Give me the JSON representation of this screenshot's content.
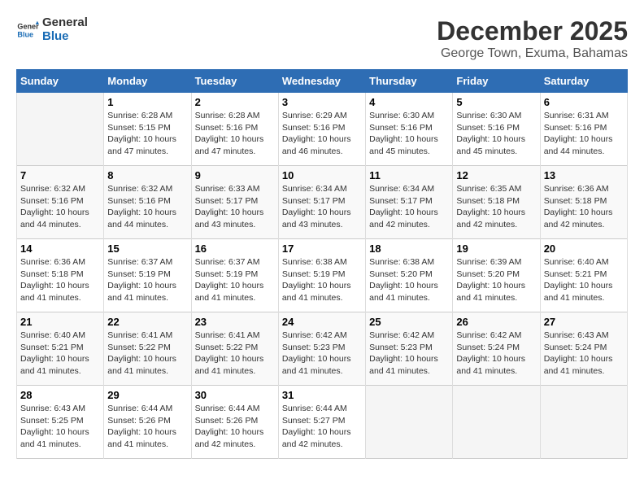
{
  "logo": {
    "general": "General",
    "blue": "Blue"
  },
  "title": "December 2025",
  "location": "George Town, Exuma, Bahamas",
  "days_of_week": [
    "Sunday",
    "Monday",
    "Tuesday",
    "Wednesday",
    "Thursday",
    "Friday",
    "Saturday"
  ],
  "weeks": [
    [
      {
        "num": "",
        "sunrise": "",
        "sunset": "",
        "daylight": ""
      },
      {
        "num": "1",
        "sunrise": "Sunrise: 6:28 AM",
        "sunset": "Sunset: 5:15 PM",
        "daylight": "Daylight: 10 hours and 47 minutes."
      },
      {
        "num": "2",
        "sunrise": "Sunrise: 6:28 AM",
        "sunset": "Sunset: 5:16 PM",
        "daylight": "Daylight: 10 hours and 47 minutes."
      },
      {
        "num": "3",
        "sunrise": "Sunrise: 6:29 AM",
        "sunset": "Sunset: 5:16 PM",
        "daylight": "Daylight: 10 hours and 46 minutes."
      },
      {
        "num": "4",
        "sunrise": "Sunrise: 6:30 AM",
        "sunset": "Sunset: 5:16 PM",
        "daylight": "Daylight: 10 hours and 45 minutes."
      },
      {
        "num": "5",
        "sunrise": "Sunrise: 6:30 AM",
        "sunset": "Sunset: 5:16 PM",
        "daylight": "Daylight: 10 hours and 45 minutes."
      },
      {
        "num": "6",
        "sunrise": "Sunrise: 6:31 AM",
        "sunset": "Sunset: 5:16 PM",
        "daylight": "Daylight: 10 hours and 44 minutes."
      }
    ],
    [
      {
        "num": "7",
        "sunrise": "Sunrise: 6:32 AM",
        "sunset": "Sunset: 5:16 PM",
        "daylight": "Daylight: 10 hours and 44 minutes."
      },
      {
        "num": "8",
        "sunrise": "Sunrise: 6:32 AM",
        "sunset": "Sunset: 5:16 PM",
        "daylight": "Daylight: 10 hours and 44 minutes."
      },
      {
        "num": "9",
        "sunrise": "Sunrise: 6:33 AM",
        "sunset": "Sunset: 5:17 PM",
        "daylight": "Daylight: 10 hours and 43 minutes."
      },
      {
        "num": "10",
        "sunrise": "Sunrise: 6:34 AM",
        "sunset": "Sunset: 5:17 PM",
        "daylight": "Daylight: 10 hours and 43 minutes."
      },
      {
        "num": "11",
        "sunrise": "Sunrise: 6:34 AM",
        "sunset": "Sunset: 5:17 PM",
        "daylight": "Daylight: 10 hours and 42 minutes."
      },
      {
        "num": "12",
        "sunrise": "Sunrise: 6:35 AM",
        "sunset": "Sunset: 5:18 PM",
        "daylight": "Daylight: 10 hours and 42 minutes."
      },
      {
        "num": "13",
        "sunrise": "Sunrise: 6:36 AM",
        "sunset": "Sunset: 5:18 PM",
        "daylight": "Daylight: 10 hours and 42 minutes."
      }
    ],
    [
      {
        "num": "14",
        "sunrise": "Sunrise: 6:36 AM",
        "sunset": "Sunset: 5:18 PM",
        "daylight": "Daylight: 10 hours and 41 minutes."
      },
      {
        "num": "15",
        "sunrise": "Sunrise: 6:37 AM",
        "sunset": "Sunset: 5:19 PM",
        "daylight": "Daylight: 10 hours and 41 minutes."
      },
      {
        "num": "16",
        "sunrise": "Sunrise: 6:37 AM",
        "sunset": "Sunset: 5:19 PM",
        "daylight": "Daylight: 10 hours and 41 minutes."
      },
      {
        "num": "17",
        "sunrise": "Sunrise: 6:38 AM",
        "sunset": "Sunset: 5:19 PM",
        "daylight": "Daylight: 10 hours and 41 minutes."
      },
      {
        "num": "18",
        "sunrise": "Sunrise: 6:38 AM",
        "sunset": "Sunset: 5:20 PM",
        "daylight": "Daylight: 10 hours and 41 minutes."
      },
      {
        "num": "19",
        "sunrise": "Sunrise: 6:39 AM",
        "sunset": "Sunset: 5:20 PM",
        "daylight": "Daylight: 10 hours and 41 minutes."
      },
      {
        "num": "20",
        "sunrise": "Sunrise: 6:40 AM",
        "sunset": "Sunset: 5:21 PM",
        "daylight": "Daylight: 10 hours and 41 minutes."
      }
    ],
    [
      {
        "num": "21",
        "sunrise": "Sunrise: 6:40 AM",
        "sunset": "Sunset: 5:21 PM",
        "daylight": "Daylight: 10 hours and 41 minutes."
      },
      {
        "num": "22",
        "sunrise": "Sunrise: 6:41 AM",
        "sunset": "Sunset: 5:22 PM",
        "daylight": "Daylight: 10 hours and 41 minutes."
      },
      {
        "num": "23",
        "sunrise": "Sunrise: 6:41 AM",
        "sunset": "Sunset: 5:22 PM",
        "daylight": "Daylight: 10 hours and 41 minutes."
      },
      {
        "num": "24",
        "sunrise": "Sunrise: 6:42 AM",
        "sunset": "Sunset: 5:23 PM",
        "daylight": "Daylight: 10 hours and 41 minutes."
      },
      {
        "num": "25",
        "sunrise": "Sunrise: 6:42 AM",
        "sunset": "Sunset: 5:23 PM",
        "daylight": "Daylight: 10 hours and 41 minutes."
      },
      {
        "num": "26",
        "sunrise": "Sunrise: 6:42 AM",
        "sunset": "Sunset: 5:24 PM",
        "daylight": "Daylight: 10 hours and 41 minutes."
      },
      {
        "num": "27",
        "sunrise": "Sunrise: 6:43 AM",
        "sunset": "Sunset: 5:24 PM",
        "daylight": "Daylight: 10 hours and 41 minutes."
      }
    ],
    [
      {
        "num": "28",
        "sunrise": "Sunrise: 6:43 AM",
        "sunset": "Sunset: 5:25 PM",
        "daylight": "Daylight: 10 hours and 41 minutes."
      },
      {
        "num": "29",
        "sunrise": "Sunrise: 6:44 AM",
        "sunset": "Sunset: 5:26 PM",
        "daylight": "Daylight: 10 hours and 41 minutes."
      },
      {
        "num": "30",
        "sunrise": "Sunrise: 6:44 AM",
        "sunset": "Sunset: 5:26 PM",
        "daylight": "Daylight: 10 hours and 42 minutes."
      },
      {
        "num": "31",
        "sunrise": "Sunrise: 6:44 AM",
        "sunset": "Sunset: 5:27 PM",
        "daylight": "Daylight: 10 hours and 42 minutes."
      },
      {
        "num": "",
        "sunrise": "",
        "sunset": "",
        "daylight": ""
      },
      {
        "num": "",
        "sunrise": "",
        "sunset": "",
        "daylight": ""
      },
      {
        "num": "",
        "sunrise": "",
        "sunset": "",
        "daylight": ""
      }
    ]
  ]
}
